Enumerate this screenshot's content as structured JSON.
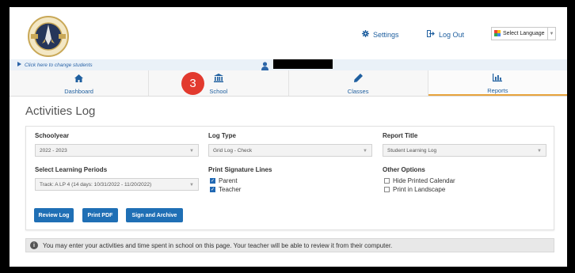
{
  "header": {
    "logo_alt": "Endeavor Explorers",
    "settings_label": "Settings",
    "logout_label": "Log Out",
    "language": {
      "selected": "Select Language",
      "caret": "▼"
    }
  },
  "student_bar": {
    "change_students": "Click here to change students"
  },
  "nav": {
    "tabs": [
      {
        "label": "Dashboard",
        "icon": "home-icon"
      },
      {
        "label": "School",
        "icon": "school-icon"
      },
      {
        "label": "Classes",
        "icon": "pencil-icon"
      },
      {
        "label": "Reports",
        "icon": "bar-chart-icon",
        "active": true
      }
    ]
  },
  "step_badge": "3",
  "page_title": "Activities Log",
  "form": {
    "schoolyear": {
      "label": "Schoolyear",
      "value": "2022 - 2023"
    },
    "log_type": {
      "label": "Log Type",
      "value": "Grid Log - Check"
    },
    "report_title": {
      "label": "Report Title",
      "value": "Student Learning Log"
    },
    "learning_periods": {
      "label": "Select Learning Periods",
      "value": "Track: A LP 4 (14 days: 10/31/2022 - 11/20/2022)"
    },
    "signature_lines": {
      "label": "Print Signature Lines",
      "options": [
        {
          "label": "Parent",
          "checked": true
        },
        {
          "label": "Teacher",
          "checked": true
        }
      ]
    },
    "other_options": {
      "label": "Other Options",
      "options": [
        {
          "label": "Hide Printed Calendar",
          "checked": false
        },
        {
          "label": "Print in Landscape",
          "checked": false
        }
      ]
    },
    "buttons": {
      "review_log": "Review Log",
      "print_pdf": "Print PDF",
      "sign_archive": "Sign and Archive"
    }
  },
  "info": {
    "icon": "i",
    "text": "You may enter your activities and time spent in school on this page. Your teacher will be able to review it from their computer."
  },
  "colors": {
    "accent": "#1f6fb5",
    "badge": "#e23a2e",
    "active_tab": "#e8a33c"
  }
}
